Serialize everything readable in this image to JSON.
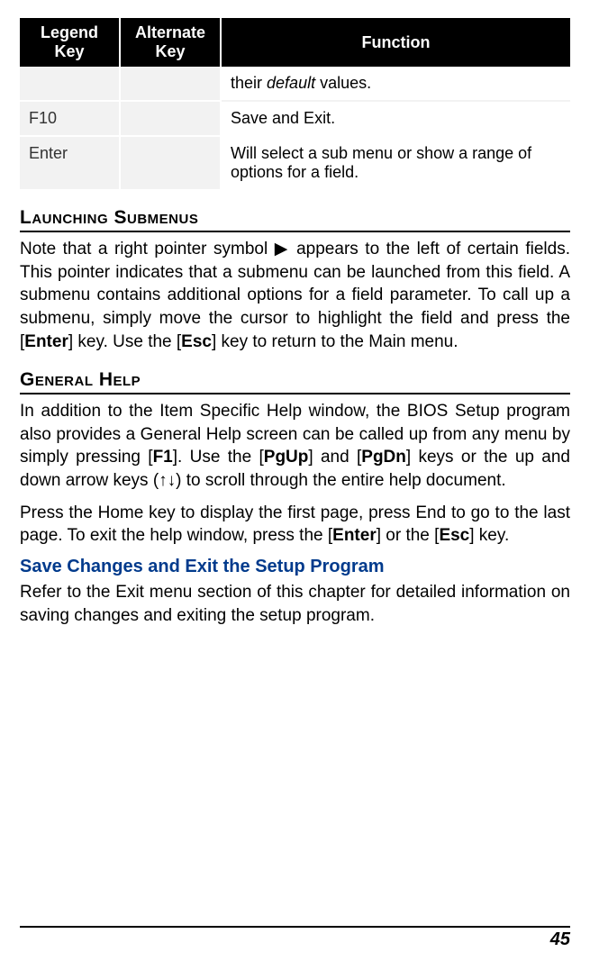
{
  "table": {
    "headers": {
      "c1": "Legend Key",
      "c2": "Alternate Key",
      "c3": "Function"
    },
    "rows": [
      {
        "key": "",
        "alt": "",
        "fn_pre": "their ",
        "fn_italic": "default",
        "fn_post": " values."
      },
      {
        "key": "F10",
        "alt": "",
        "fn": "Save and Exit."
      },
      {
        "key": "Enter",
        "alt": "",
        "fn": "Will select a sub menu or show a range of options for a field."
      }
    ]
  },
  "sections": {
    "launching": {
      "title": "Launching Submenus",
      "text": {
        "p1a": "Note that a right pointer symbol  ",
        "arrow": "▶",
        "p1b": "  appears to the left of certain fields. This pointer indicates that a submenu can be launched from this field. A submenu contains additional options for a field parameter. To call up a submenu, simply move the cursor to highlight the field and press the [",
        "enter": "Enter",
        "p1c": "] key. Use the [",
        "esc": "Esc",
        "p1d": "] key to return to the Main menu."
      }
    },
    "general": {
      "title": "General Help",
      "p1": {
        "a": "In addition to the Item Specific Help window, the BIOS Setup program also provides a General Help screen can be called up from any menu by simply pressing [",
        "f1": "F1",
        "b": "]. Use the [",
        "pgup": "PgUp",
        "c": "] and [",
        "pgdn": "PgDn",
        "d": "] keys or the up and down arrow keys (↑↓) to scroll through the entire help document."
      },
      "p2": {
        "a": "Press the Home key to display the first page, press End to go to the last page. To exit the help window, press the [",
        "enter": "Enter",
        "b": "] or the [",
        "esc": "Esc",
        "c": "] key."
      },
      "sub_title": "Save Changes and Exit the Setup Program",
      "p3": "Refer to the Exit menu section of this chapter for detailed information on saving changes and exiting the setup program."
    }
  },
  "page_number": "45"
}
